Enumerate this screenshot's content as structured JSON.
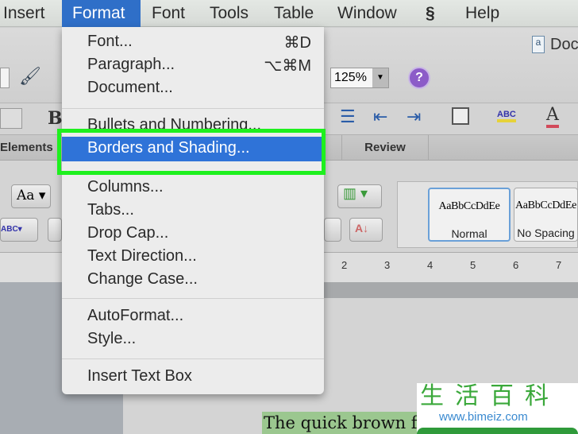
{
  "menubar": {
    "items": [
      "Insert",
      "Format",
      "Font",
      "Tools",
      "Table",
      "Window",
      "Help"
    ],
    "script_icon": "script-icon"
  },
  "toolbar": {
    "zoom": "125%",
    "doc_label": "Doc",
    "bold": "B"
  },
  "ribbon": {
    "tabs": [
      "Elements",
      "Review"
    ],
    "styles": [
      {
        "preview": "AaBbCcDdEe",
        "name": "Normal"
      },
      {
        "preview": "AaBbCcDdEe",
        "name": "No Spacing"
      }
    ],
    "ruler_labels": [
      "2",
      "3",
      "4",
      "5",
      "6",
      "7"
    ]
  },
  "format_menu": {
    "items": [
      {
        "label": "Font...",
        "shortcut": "⌘D"
      },
      {
        "label": "Paragraph...",
        "shortcut": "⌥⌘M"
      },
      {
        "label": "Document..."
      },
      {
        "label": "Bullets and Numbering..."
      },
      {
        "label": "Borders and Shading...",
        "highlighted": true
      },
      {
        "label": "Columns..."
      },
      {
        "label": "Tabs..."
      },
      {
        "label": "Drop Cap..."
      },
      {
        "label": "Text Direction..."
      },
      {
        "label": "Change Case..."
      },
      {
        "label": "AutoFormat..."
      },
      {
        "label": "Style..."
      },
      {
        "label": "Insert Text Box"
      }
    ]
  },
  "document": {
    "text": "The quick brown fox jumps over the lazy dog"
  },
  "watermark": {
    "chars": "生活百科",
    "url": "www.bimeiz.com"
  },
  "colors": {
    "highlight": "#2f73d8",
    "callout": "#1ef01e",
    "text_highlight": "#9bc78f"
  }
}
